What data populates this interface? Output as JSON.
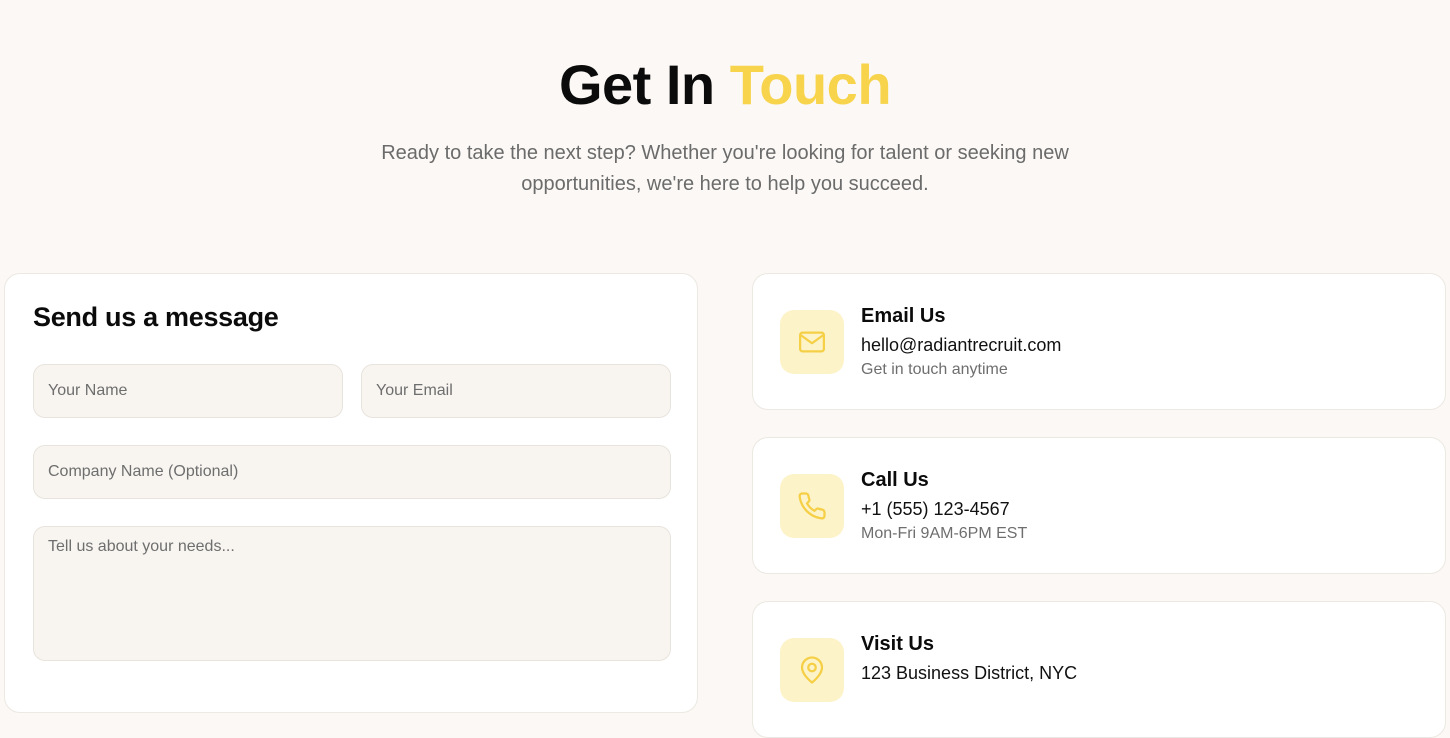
{
  "header": {
    "title_main": "Get In",
    "title_accent": "Touch",
    "subtitle": "Ready to take the next step? Whether you're looking for talent or seeking new opportunities, we're here to help you succeed."
  },
  "form": {
    "title": "Send us a message",
    "name_placeholder": "Your Name",
    "email_placeholder": "Your Email",
    "company_placeholder": "Company Name (Optional)",
    "message_placeholder": "Tell us about your needs..."
  },
  "contacts": [
    {
      "icon": "mail-icon",
      "title": "Email Us",
      "value": "hello@radiantrecruit.com",
      "note": "Get in touch anytime"
    },
    {
      "icon": "phone-icon",
      "title": "Call Us",
      "value": "+1 (555) 123-4567",
      "note": "Mon-Fri 9AM-6PM EST"
    },
    {
      "icon": "map-pin-icon",
      "title": "Visit Us",
      "value": "123 Business District, NYC",
      "note": ""
    }
  ],
  "colors": {
    "accent": "#f7d44c",
    "icon_bg": "#fdf3c9",
    "page_bg": "#fbf8f5"
  }
}
